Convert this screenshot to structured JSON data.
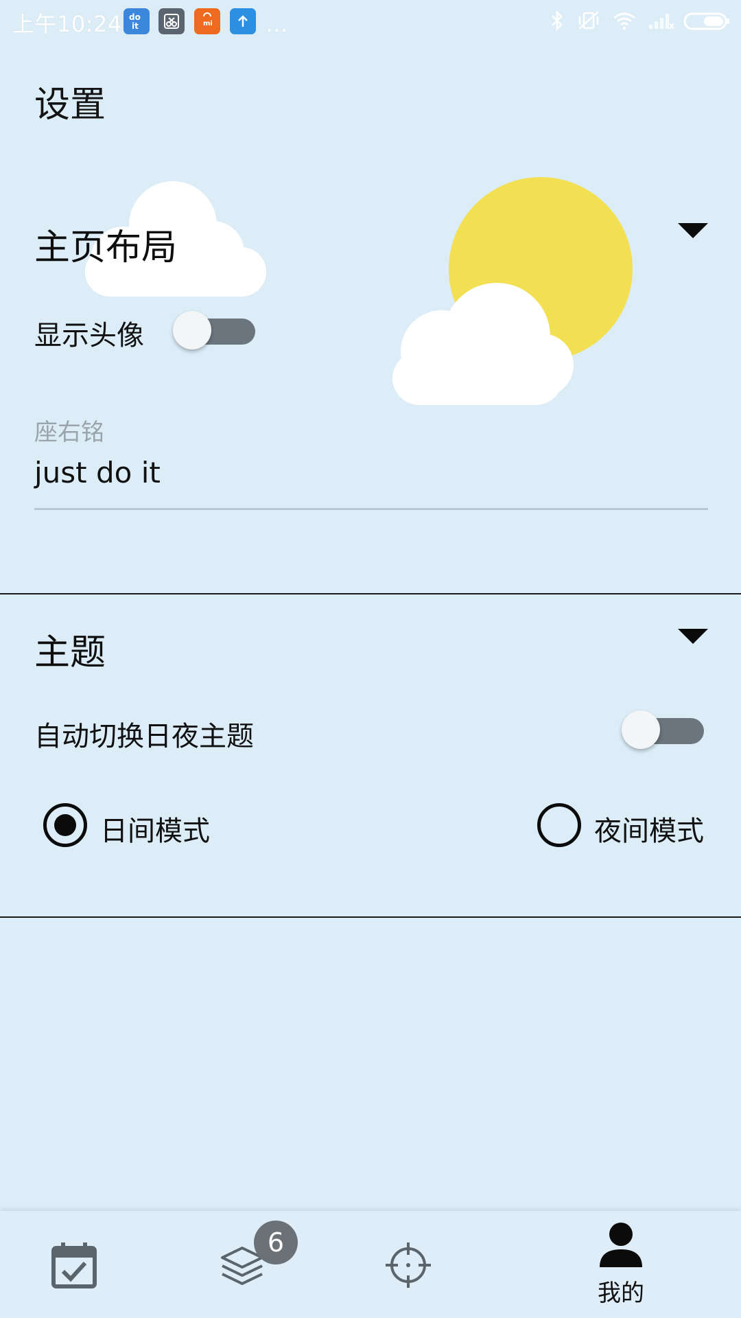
{
  "status_bar": {
    "time": "上午10:24",
    "notification_icons": [
      "doit-app-icon",
      "scissors-app-icon",
      "mi-store-icon",
      "upload-icon"
    ],
    "overflow": "...",
    "right_icons": [
      "bluetooth-icon",
      "vibrate-off-icon",
      "wifi-icon",
      "signal-icon",
      "battery-icon"
    ]
  },
  "page": {
    "title": "设置"
  },
  "home_layout": {
    "title": "主页布局",
    "show_avatar_label": "显示头像",
    "show_avatar_enabled": false,
    "motto_label": "座右铭",
    "motto_value": "just do it"
  },
  "theme": {
    "title": "主题",
    "auto_switch_label": "自动切换日夜主题",
    "auto_switch_enabled": false,
    "day_mode_label": "日间模式",
    "night_mode_label": "夜间模式",
    "selected_mode": "日间模式"
  },
  "bottom_nav": {
    "items": [
      {
        "icon": "calendar-check-icon",
        "label": ""
      },
      {
        "icon": "layers-icon",
        "label": "",
        "badge": "6"
      },
      {
        "icon": "crosshair-icon",
        "label": ""
      },
      {
        "icon": "person-icon",
        "label": "我的"
      }
    ]
  },
  "colors": {
    "background": "#dcedf8",
    "sun": "#f2df52",
    "cloud": "#ffffff",
    "toggle_track": "#6b757d",
    "badge": "#6a7278"
  }
}
